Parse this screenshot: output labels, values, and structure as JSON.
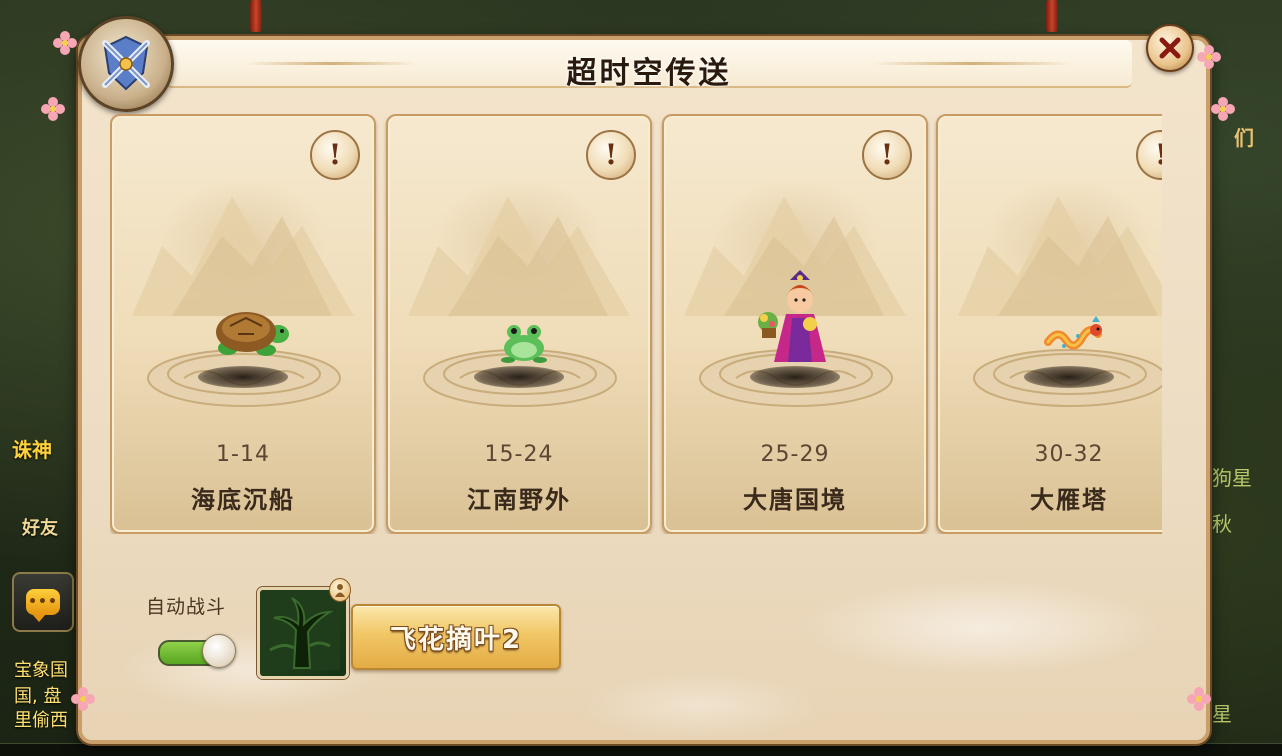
{
  "panel": {
    "title": "超时空传送",
    "close_icon": "close-x-icon",
    "emblem_icon": "crossed-swords-shield-icon"
  },
  "cards": [
    {
      "level": "1-14",
      "name": "海底沉船",
      "creature": "turtle"
    },
    {
      "level": "15-24",
      "name": "江南野外",
      "creature": "frog"
    },
    {
      "level": "25-29",
      "name": "大唐国境",
      "creature": "flower-girl"
    },
    {
      "level": "30-32",
      "name": "大雁塔",
      "creature": "dragon"
    }
  ],
  "info_button_label": "!",
  "auto_battle": {
    "label": "自动战斗",
    "enabled": true
  },
  "skill": {
    "label": "飞花摘叶2",
    "icon": "tree-skill-icon",
    "badge_icon": "person-icon"
  },
  "background": {
    "left_texts": [
      "诛神",
      "好友",
      "宝象国",
      "国, 盘",
      "里偷西"
    ],
    "right_texts": [
      "狗星",
      "秋",
      "星",
      "们"
    ],
    "chat_icon": "chat-bubble-icon"
  },
  "colors": {
    "panel_bg": "#ecdcc2",
    "panel_border": "#c9a06b",
    "toggle_on": "#58a620",
    "skill_button": "#f1c766"
  }
}
